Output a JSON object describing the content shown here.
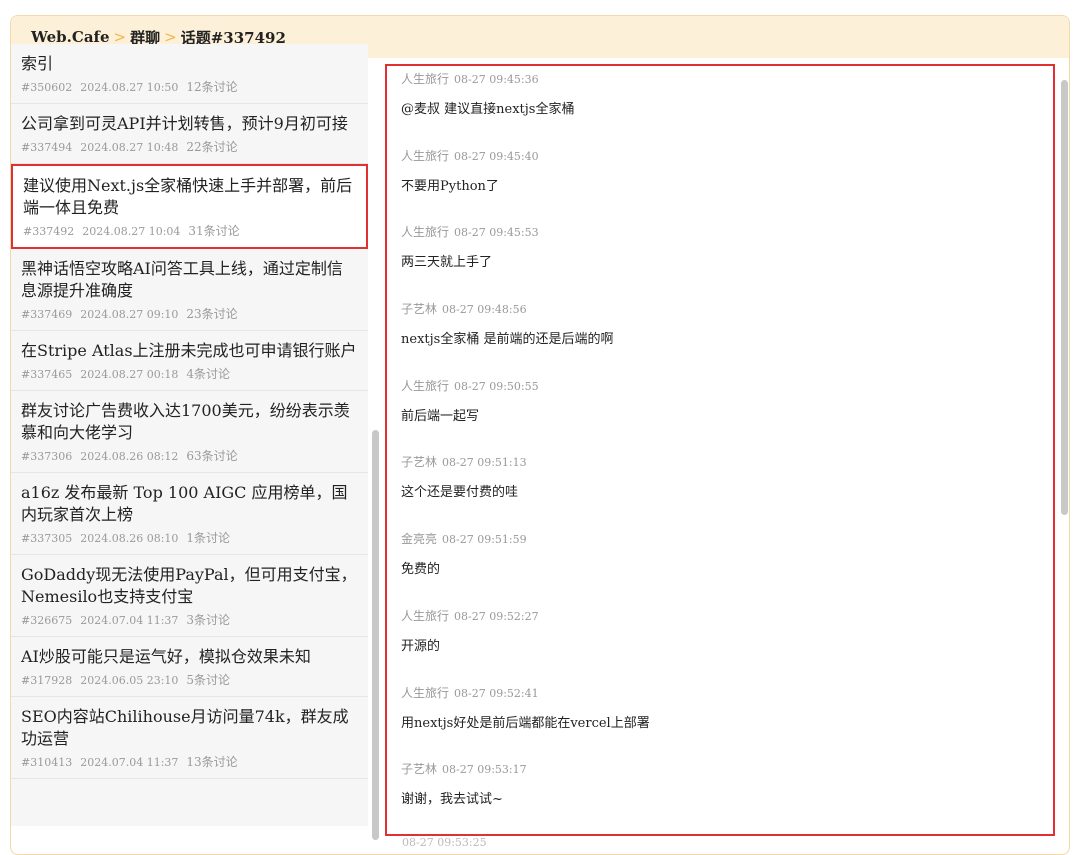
{
  "breadcrumb": {
    "site": "Web.Cafe",
    "sep": ">",
    "section": "群聊",
    "topic": "话题#337492"
  },
  "topics": [
    {
      "title": "索引",
      "id": "#350602",
      "date": "2024.08.27 10:50",
      "count": "12条讨论"
    },
    {
      "title": "公司拿到可灵API并计划转售，预计9月初可接",
      "id": "#337494",
      "date": "2024.08.27 10:48",
      "count": "22条讨论"
    },
    {
      "title": "建议使用Next.js全家桶快速上手并部署，前后端一体且免费",
      "id": "#337492",
      "date": "2024.08.27 10:04",
      "count": "31条讨论"
    },
    {
      "title": "黑神话悟空攻略AI问答工具上线，通过定制信息源提升准确度",
      "id": "#337469",
      "date": "2024.08.27 09:10",
      "count": "23条讨论"
    },
    {
      "title": "在Stripe Atlas上注册未完成也可申请银行账户",
      "id": "#337465",
      "date": "2024.08.27 00:18",
      "count": "4条讨论"
    },
    {
      "title": "群友讨论广告费收入达1700美元，纷纷表示羡慕和向大佬学习",
      "id": "#337306",
      "date": "2024.08.26 08:12",
      "count": "63条讨论"
    },
    {
      "title": "a16z 发布最新 Top 100 AIGC 应用榜单，国内玩家首次上榜",
      "id": "#337305",
      "date": "2024.08.26 08:10",
      "count": "1条讨论"
    },
    {
      "title": "GoDaddy现无法使用PayPal，但可用支付宝，Nemesilo也支持支付宝",
      "id": "#326675",
      "date": "2024.07.04 11:37",
      "count": "3条讨论"
    },
    {
      "title": "AI炒股可能只是运气好，模拟仓效果未知",
      "id": "#317928",
      "date": "2024.06.05 23:10",
      "count": "5条讨论"
    },
    {
      "title": "SEO内容站Chilihouse月访问量74k，群友成功运营",
      "id": "#310413",
      "date": "2024.07.04 11:37",
      "count": "13条讨论"
    }
  ],
  "messages": [
    {
      "user": "人生旅行",
      "time": "08-27 09:45:36",
      "text": "@麦叔 建议直接nextjs全家桶"
    },
    {
      "user": "人生旅行",
      "time": "08-27 09:45:40",
      "text": "不要用Python了"
    },
    {
      "user": "人生旅行",
      "time": "08-27 09:45:53",
      "text": "两三天就上手了"
    },
    {
      "user": "子艺林",
      "time": "08-27 09:48:56",
      "text": "nextjs全家桶 是前端的还是后端的啊"
    },
    {
      "user": "人生旅行",
      "time": "08-27 09:50:55",
      "text": "前后端一起写"
    },
    {
      "user": "子艺林",
      "time": "08-27 09:51:13",
      "text": "这个还是要付费的哇"
    },
    {
      "user": "金亮亮",
      "time": "08-27 09:51:59",
      "text": "免费的"
    },
    {
      "user": "人生旅行",
      "time": "08-27 09:52:27",
      "text": "开源的"
    },
    {
      "user": "人生旅行",
      "time": "08-27 09:52:41",
      "text": "用nextjs好处是前后端都能在vercel上部署"
    },
    {
      "user": "子艺林",
      "time": "08-27 09:53:17",
      "text": "谢谢，我去试试~"
    }
  ],
  "peek_time": "08-27 09:53:25",
  "colors": {
    "accent": "#f3b34a",
    "highlight": "#e03030",
    "header_bg": "#fdf0d8"
  }
}
